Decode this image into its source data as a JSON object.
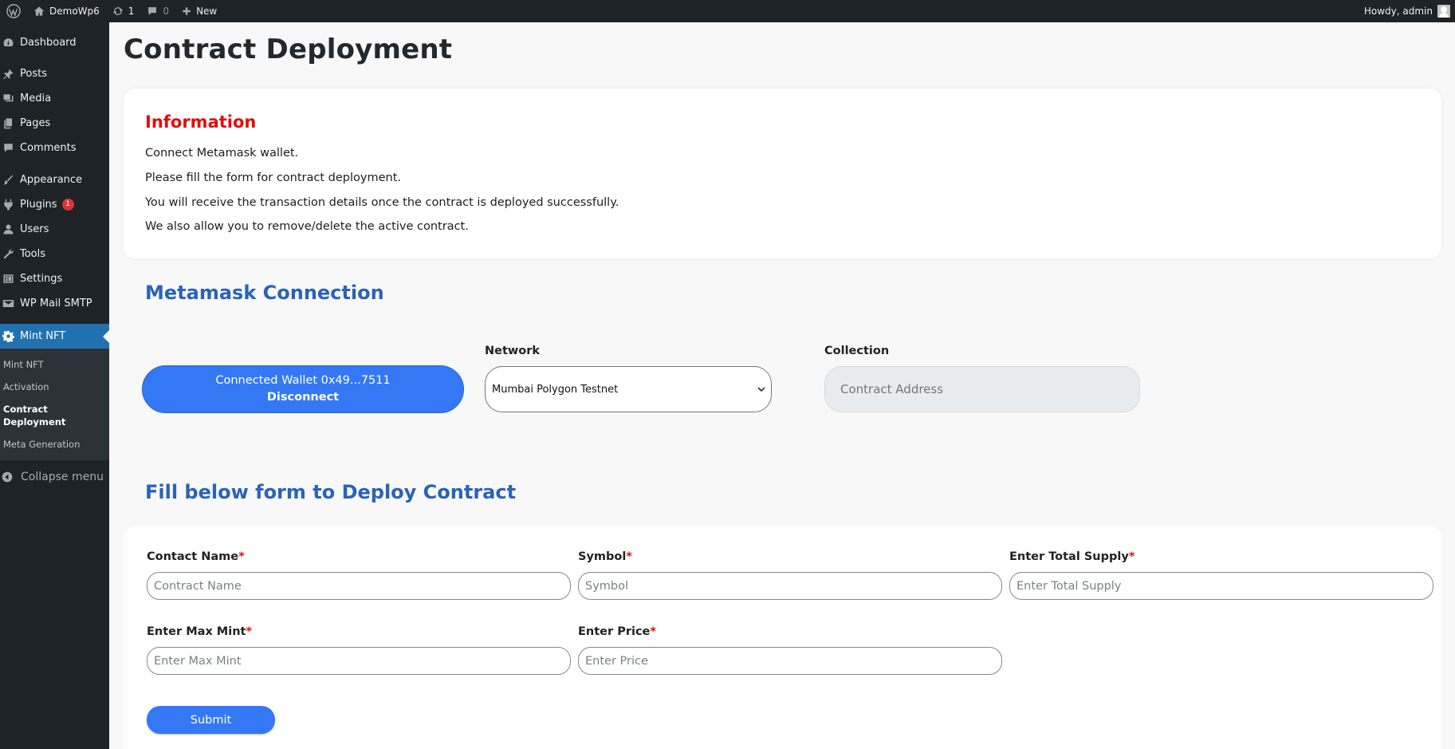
{
  "adminbar": {
    "site_name": "DemoWp6",
    "updates_count": "1",
    "comments_count": "0",
    "new_label": "New",
    "howdy": "Howdy, admin"
  },
  "sidebar": {
    "items": [
      {
        "label": "Dashboard",
        "icon": "dashboard-icon"
      },
      {
        "label": "Posts",
        "icon": "pin-icon"
      },
      {
        "label": "Media",
        "icon": "media-icon"
      },
      {
        "label": "Pages",
        "icon": "pages-icon"
      },
      {
        "label": "Comments",
        "icon": "comment-icon"
      },
      {
        "label": "Appearance",
        "icon": "brush-icon"
      },
      {
        "label": "Plugins",
        "icon": "plug-icon",
        "badge": "1"
      },
      {
        "label": "Users",
        "icon": "user-icon"
      },
      {
        "label": "Tools",
        "icon": "wrench-icon"
      },
      {
        "label": "Settings",
        "icon": "settings-icon"
      },
      {
        "label": "WP Mail SMTP",
        "icon": "mail-icon"
      },
      {
        "label": "Mint NFT",
        "icon": "gear-icon",
        "active": true
      }
    ],
    "submenu": [
      "Mint NFT",
      "Activation",
      "Contract Deployment",
      "Meta Generation"
    ],
    "collapse_label": "Collapse menu"
  },
  "main": {
    "page_title": "Contract Deployment",
    "info": {
      "heading": "Information",
      "lines": [
        "Connect Metamask wallet.",
        "Please fill the form for contract deployment.",
        "You will receive the transaction details once the contract is deployed successfully.",
        "We also allow you to remove/delete the active contract."
      ]
    },
    "metamask": {
      "heading": "Metamask Connection",
      "wallet_label": "Connected Wallet 0x49...7511",
      "disconnect_label": "Disconnect",
      "network_label": "Network",
      "network_value": "Mumbai Polygon Testnet",
      "collection_label": "Collection",
      "collection_placeholder": "Contract Address"
    },
    "form": {
      "heading": "Fill below form to Deploy Contract",
      "contract_name_label": "Contact Name",
      "contract_name_placeholder": "Contract Name",
      "symbol_label": "Symbol",
      "symbol_placeholder": "Symbol",
      "total_supply_label": "Enter Total Supply",
      "total_supply_placeholder": "Enter Total Supply",
      "max_mint_label": "Enter Max Mint",
      "max_mint_placeholder": "Enter Max Mint",
      "price_label": "Enter Price",
      "price_placeholder": "Enter Price",
      "required_mark": "*",
      "submit_label": "Submit"
    }
  },
  "colors": {
    "accent_blue": "#3478f6",
    "heading_blue": "#2a63b8",
    "info_red": "#e00e0e",
    "admin_dark": "#1d2327",
    "menu_active": "#2271b1"
  }
}
